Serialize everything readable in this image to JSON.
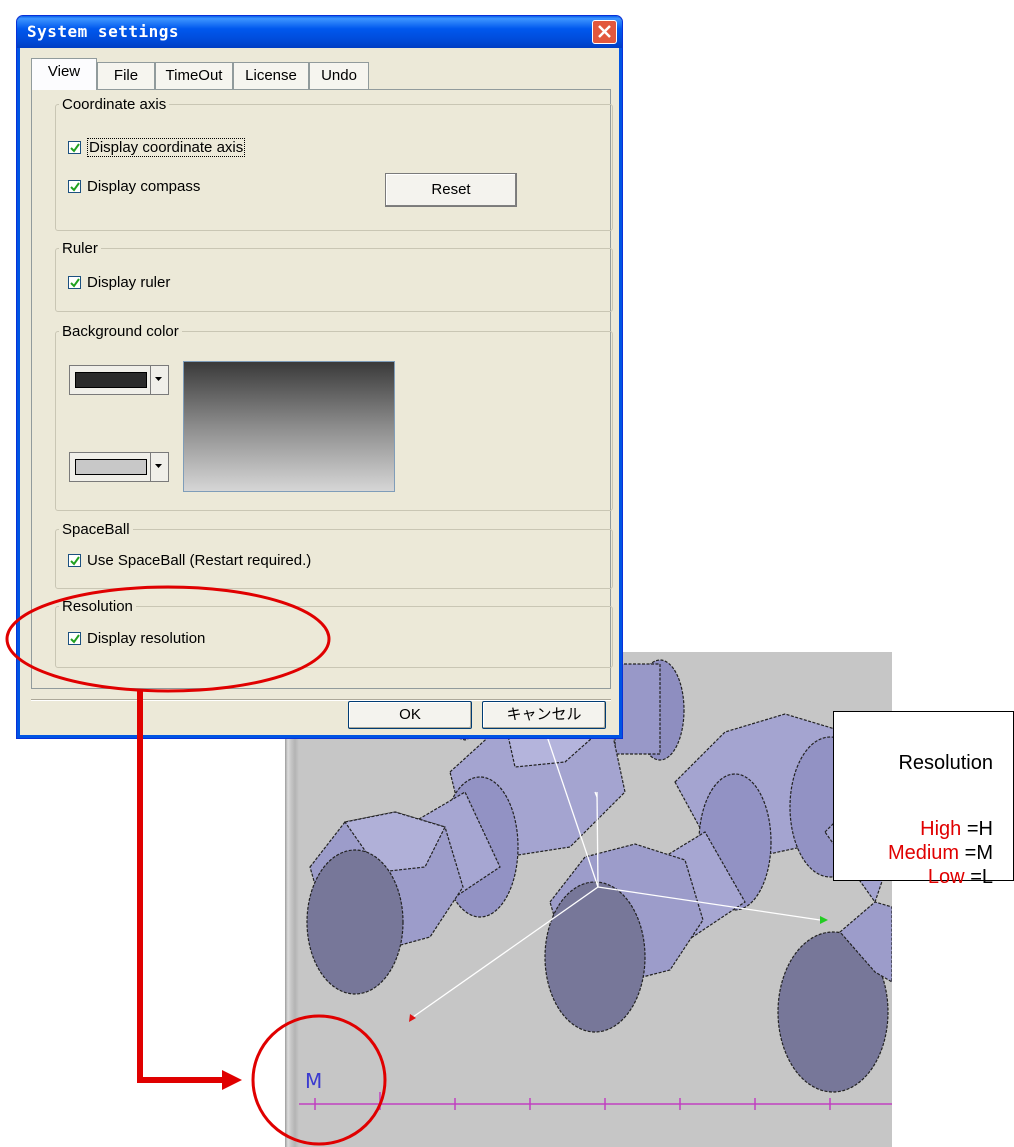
{
  "dialog": {
    "title": "System settings",
    "tabs": [
      "View",
      "File",
      "TimeOut",
      "License",
      "Undo"
    ],
    "groups": {
      "coordinate_axis": {
        "title": "Coordinate axis",
        "display_axis": {
          "label": "Display coordinate axis",
          "checked": true
        },
        "display_compass": {
          "label": "Display compass",
          "checked": true
        },
        "reset_button": "Reset"
      },
      "ruler": {
        "title": "Ruler",
        "display_ruler": {
          "label": "Display ruler",
          "checked": true
        }
      },
      "background_color": {
        "title": "Background color",
        "top_color": "#2b2b2b",
        "bottom_color": "#c8c8c8"
      },
      "spaceball": {
        "title": "SpaceBall",
        "use_spaceball": {
          "label": "Use SpaceBall (Restart required.)",
          "checked": true
        }
      },
      "resolution": {
        "title": "Resolution",
        "display_resolution": {
          "label": "Display resolution",
          "checked": true
        }
      }
    },
    "buttons": {
      "ok": "OK",
      "cancel": "キャンセル"
    }
  },
  "viewport": {
    "resolution_indicator": "M"
  },
  "legend": {
    "title": "Resolution",
    "rows": [
      {
        "level": "High",
        "code": "=H"
      },
      {
        "level": "Medium",
        "code": "=M"
      },
      {
        "level": "Low",
        "code": "=L"
      }
    ]
  },
  "colors": {
    "highlight": "#e00000",
    "viewport_bg": "#c6c6c6",
    "bolt": "#8e8ec0"
  }
}
